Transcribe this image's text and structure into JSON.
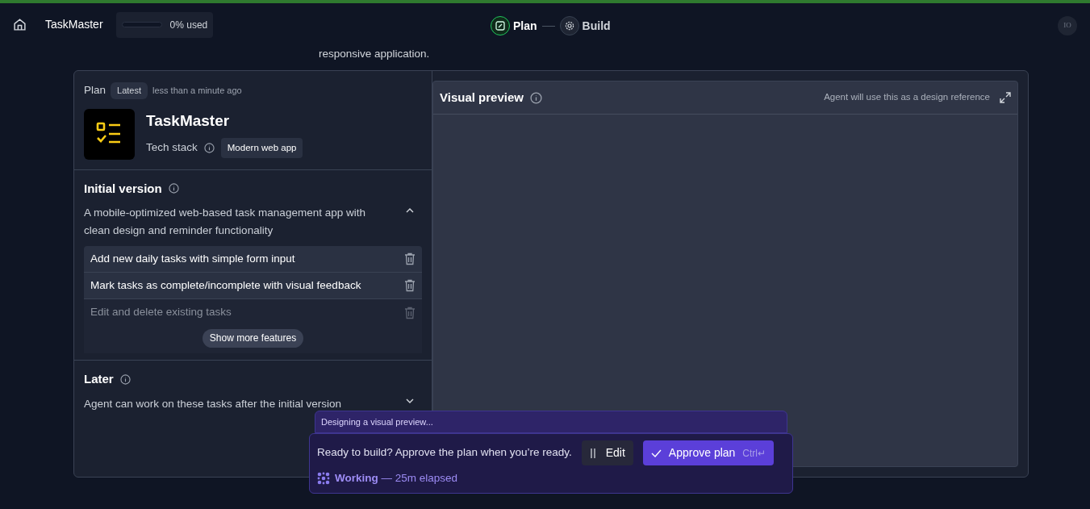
{
  "header": {
    "project": "TaskMaster",
    "usage": {
      "level": 0,
      "label": "0% used"
    },
    "steps": [
      {
        "label": "Plan",
        "selected": true
      },
      {
        "label": "Build",
        "selected": false
      }
    ],
    "avatar": "IO"
  },
  "intro_tail": "responsive application.",
  "plan": {
    "title": "Plan",
    "badge": "Latest",
    "time": "less than a minute ago",
    "app_name": "TaskMaster",
    "tech_label": "Tech stack",
    "tech_value": "Modern web app",
    "sections": [
      {
        "title": "Initial version",
        "description": "A mobile-optimized web-based task management app with clean design and reminder functionality",
        "expanded": true,
        "features": [
          {
            "text": "Add new daily tasks with simple form input",
            "faded": false
          },
          {
            "text": "Mark tasks as complete/incomplete with visual feedback",
            "faded": false
          },
          {
            "text": "Edit and delete existing tasks",
            "faded": true
          }
        ],
        "more_button": "Show more features"
      },
      {
        "title": "Later",
        "description": "Agent can work on these tasks after the initial version",
        "expanded": false
      }
    ]
  },
  "preview": {
    "title": "Visual preview",
    "note": "Agent will use this as a design reference"
  },
  "popup": {
    "status": "Designing a visual preview...",
    "message": "Ready to build? Approve the plan when you’re ready.",
    "edit": "Edit",
    "approve": "Approve plan",
    "shortcut": "Ctrl↵",
    "working": "Working",
    "elapsed": "— 25m elapsed"
  }
}
